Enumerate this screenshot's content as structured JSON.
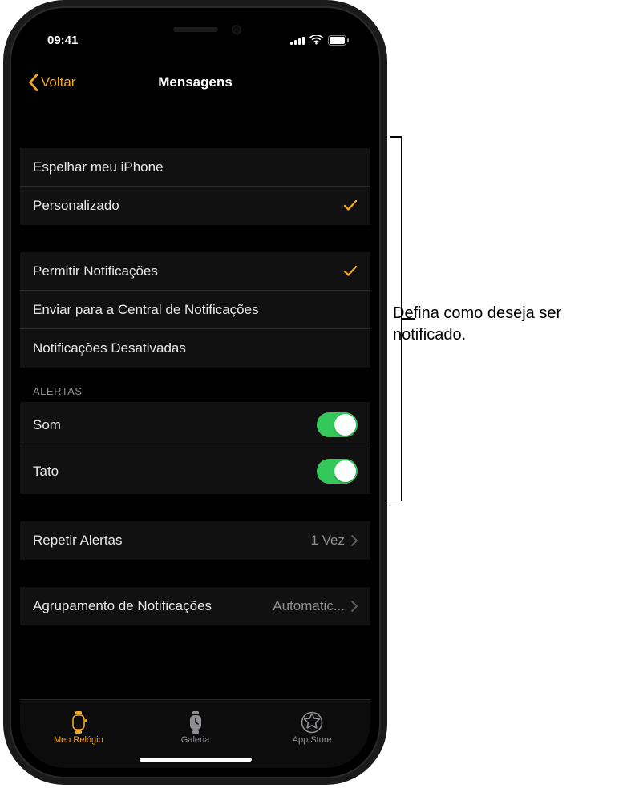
{
  "statusbar": {
    "time": "09:41"
  },
  "nav": {
    "back": "Voltar",
    "title": "Mensagens"
  },
  "mirror_group": {
    "mirror": "Espelhar meu iPhone",
    "custom": "Personalizado"
  },
  "notify_group": {
    "allow": "Permitir Notificações",
    "send_center": "Enviar para a Central de Notificações",
    "off": "Notificações Desativadas"
  },
  "alerts": {
    "header": "Alertas",
    "sound": "Som",
    "haptic": "Tato"
  },
  "repeat": {
    "label": "Repetir Alertas",
    "value": "1 Vez"
  },
  "grouping": {
    "label": "Agrupamento de Notificações",
    "value": "Automatic..."
  },
  "tabs": {
    "mywatch": "Meu Relógio",
    "gallery": "Galeria",
    "appstore": "App Store"
  },
  "callout": "Defina como deseja ser notificado."
}
